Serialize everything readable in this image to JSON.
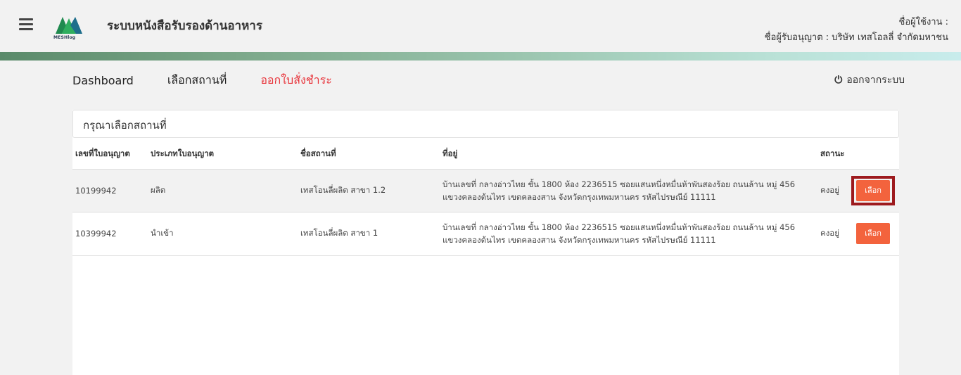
{
  "header": {
    "app_title": "ระบบหนังสือรับรองด้านอาหาร",
    "logo_text": "MESHlog",
    "user_label": "ชื่อผู้ใช้งาน :",
    "licensee_label": "ชื่อผู้รับอนุญาต : บริษัท เทสโอลลี่ จำกัดมหาชน"
  },
  "nav": {
    "items": [
      {
        "label": "Dashboard"
      },
      {
        "label": "เลือกสถานที่"
      },
      {
        "label": "ออกใบสั่งชำระ"
      }
    ],
    "logout_label": "ออกจากระบบ"
  },
  "panel": {
    "title": "กรุณาเลือกสถานที่",
    "columns": [
      "เลขที่ใบอนุญาต",
      "ประเภทใบอนุญาต",
      "ชื่อสถานที่",
      "ที่อยู่",
      "สถานะ"
    ],
    "rows": [
      {
        "license_no": "10199942",
        "license_type": "ผลิต",
        "place_name": "เทสโอนลี่ผลิต สาขา 1.2",
        "address_line1": "บ้านเลขที่ กลางอ่าวไทย ชั้น 1800 ห้อง 2236515 ซอยแสนหนึ่งหมื่นห้าพันสองร้อย ถนนล้าน หมู่ 456",
        "address_line2": "แขวงคลองต้นไทร เขตคลองสาน จังหวัดกรุงเทพมหานคร รหัสไปรษณีย์ 11111",
        "status": "คงอยู่",
        "button_label": "เลือก"
      },
      {
        "license_no": "10399942",
        "license_type": "นำเข้า",
        "place_name": "เทสโอนลี่ผลิต สาขา 1",
        "address_line1": "บ้านเลขที่ กลางอ่าวไทย ชั้น 1800 ห้อง 2236515 ซอยแสนหนึ่งหมื่นห้าพันสองร้อย ถนนล้าน หมู่ 456",
        "address_line2": "แขวงคลองต้นไทร เขตคลองสาน จังหวัดกรุงเทพมหานคร รหัสไปรษณีย์ 11111",
        "status": "คงอยู่",
        "button_label": "เลือก"
      }
    ]
  },
  "colors": {
    "active_nav": "#e8333a",
    "select_button": "#f3633d",
    "highlight_border": "#9d1a1e"
  },
  "icons": {
    "menu": "hamburger-icon",
    "logout": "power-icon"
  }
}
